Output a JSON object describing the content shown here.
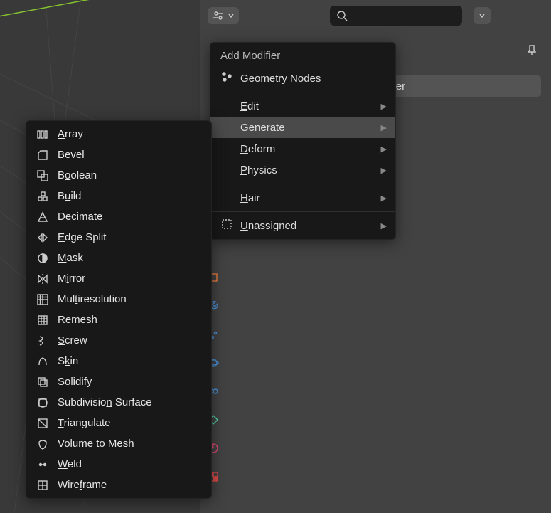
{
  "header": {
    "search_placeholder": ""
  },
  "add_modifier_button": "Modifier",
  "main_menu": {
    "title": "Add Modifier",
    "items": [
      {
        "label_pre": "",
        "mn": "G",
        "label_post": "eometry Nodes",
        "icon": "nodes",
        "arrow": false,
        "highlight": false
      },
      {
        "sep": true
      },
      {
        "label_pre": "",
        "mn": "E",
        "label_post": "dit",
        "icon": "",
        "arrow": true,
        "highlight": false,
        "indent": true
      },
      {
        "label_pre": "Ge",
        "mn": "n",
        "label_post": "erate",
        "icon": "",
        "arrow": true,
        "highlight": true,
        "indent": true
      },
      {
        "label_pre": "",
        "mn": "D",
        "label_post": "eform",
        "icon": "",
        "arrow": true,
        "highlight": false,
        "indent": true
      },
      {
        "label_pre": "",
        "mn": "P",
        "label_post": "hysics",
        "icon": "",
        "arrow": true,
        "highlight": false,
        "indent": true
      },
      {
        "sep": true
      },
      {
        "label_pre": "",
        "mn": "H",
        "label_post": "air",
        "icon": "",
        "arrow": true,
        "highlight": false,
        "indent": true
      },
      {
        "sep": true
      },
      {
        "label_pre": "",
        "mn": "U",
        "label_post": "nassigned",
        "icon": "unassigned",
        "arrow": true,
        "highlight": false
      }
    ]
  },
  "sub_menu": {
    "items": [
      {
        "pre": "",
        "mn": "A",
        "post": "rray",
        "icon": "array"
      },
      {
        "pre": "",
        "mn": "B",
        "post": "evel",
        "icon": "bevel"
      },
      {
        "pre": "B",
        "mn": "o",
        "post": "olean",
        "icon": "boolean"
      },
      {
        "pre": "B",
        "mn": "u",
        "post": "ild",
        "icon": "build"
      },
      {
        "pre": "",
        "mn": "D",
        "post": "ecimate",
        "icon": "decimate"
      },
      {
        "pre": "",
        "mn": "E",
        "post": "dge Split",
        "icon": "edgesplit"
      },
      {
        "pre": "",
        "mn": "M",
        "post": "ask",
        "icon": "mask"
      },
      {
        "pre": "M",
        "mn": "i",
        "post": "rror",
        "icon": "mirror"
      },
      {
        "pre": "Mul",
        "mn": "t",
        "post": "iresolution",
        "icon": "multires"
      },
      {
        "pre": "",
        "mn": "R",
        "post": "emesh",
        "icon": "remesh"
      },
      {
        "pre": "",
        "mn": "S",
        "post": "crew",
        "icon": "screw"
      },
      {
        "pre": "S",
        "mn": "k",
        "post": "in",
        "icon": "skin"
      },
      {
        "pre": "Solidi",
        "mn": "f",
        "post": "y",
        "icon": "solidify"
      },
      {
        "pre": "Subdivisio",
        "mn": "n",
        "post": " Surface",
        "icon": "subsurf"
      },
      {
        "pre": "",
        "mn": "T",
        "post": "riangulate",
        "icon": "triangulate"
      },
      {
        "pre": "",
        "mn": "V",
        "post": "olume to Mesh",
        "icon": "volume"
      },
      {
        "pre": "",
        "mn": "W",
        "post": "eld",
        "icon": "weld"
      },
      {
        "pre": "Wire",
        "mn": "f",
        "post": "rame",
        "icon": "wireframe"
      }
    ]
  },
  "sidebar_tabs": [
    {
      "icon": "object",
      "color": "#e87d3e",
      "active": true
    },
    {
      "icon": "wrench",
      "color": "#4a90d9",
      "active": false
    },
    {
      "icon": "particles",
      "color": "#4a90d9",
      "active": false
    },
    {
      "icon": "physics",
      "color": "#4a90d9",
      "active": false
    },
    {
      "icon": "constraint",
      "color": "#4a90d9",
      "active": false
    },
    {
      "icon": "data",
      "color": "#4fd4a6",
      "active": false
    },
    {
      "icon": "material",
      "color": "#d94a6f",
      "active": false
    },
    {
      "icon": "checker",
      "color": "#d94a4a",
      "active": false
    }
  ],
  "colors": {
    "grid_accent": "#84c22e"
  }
}
